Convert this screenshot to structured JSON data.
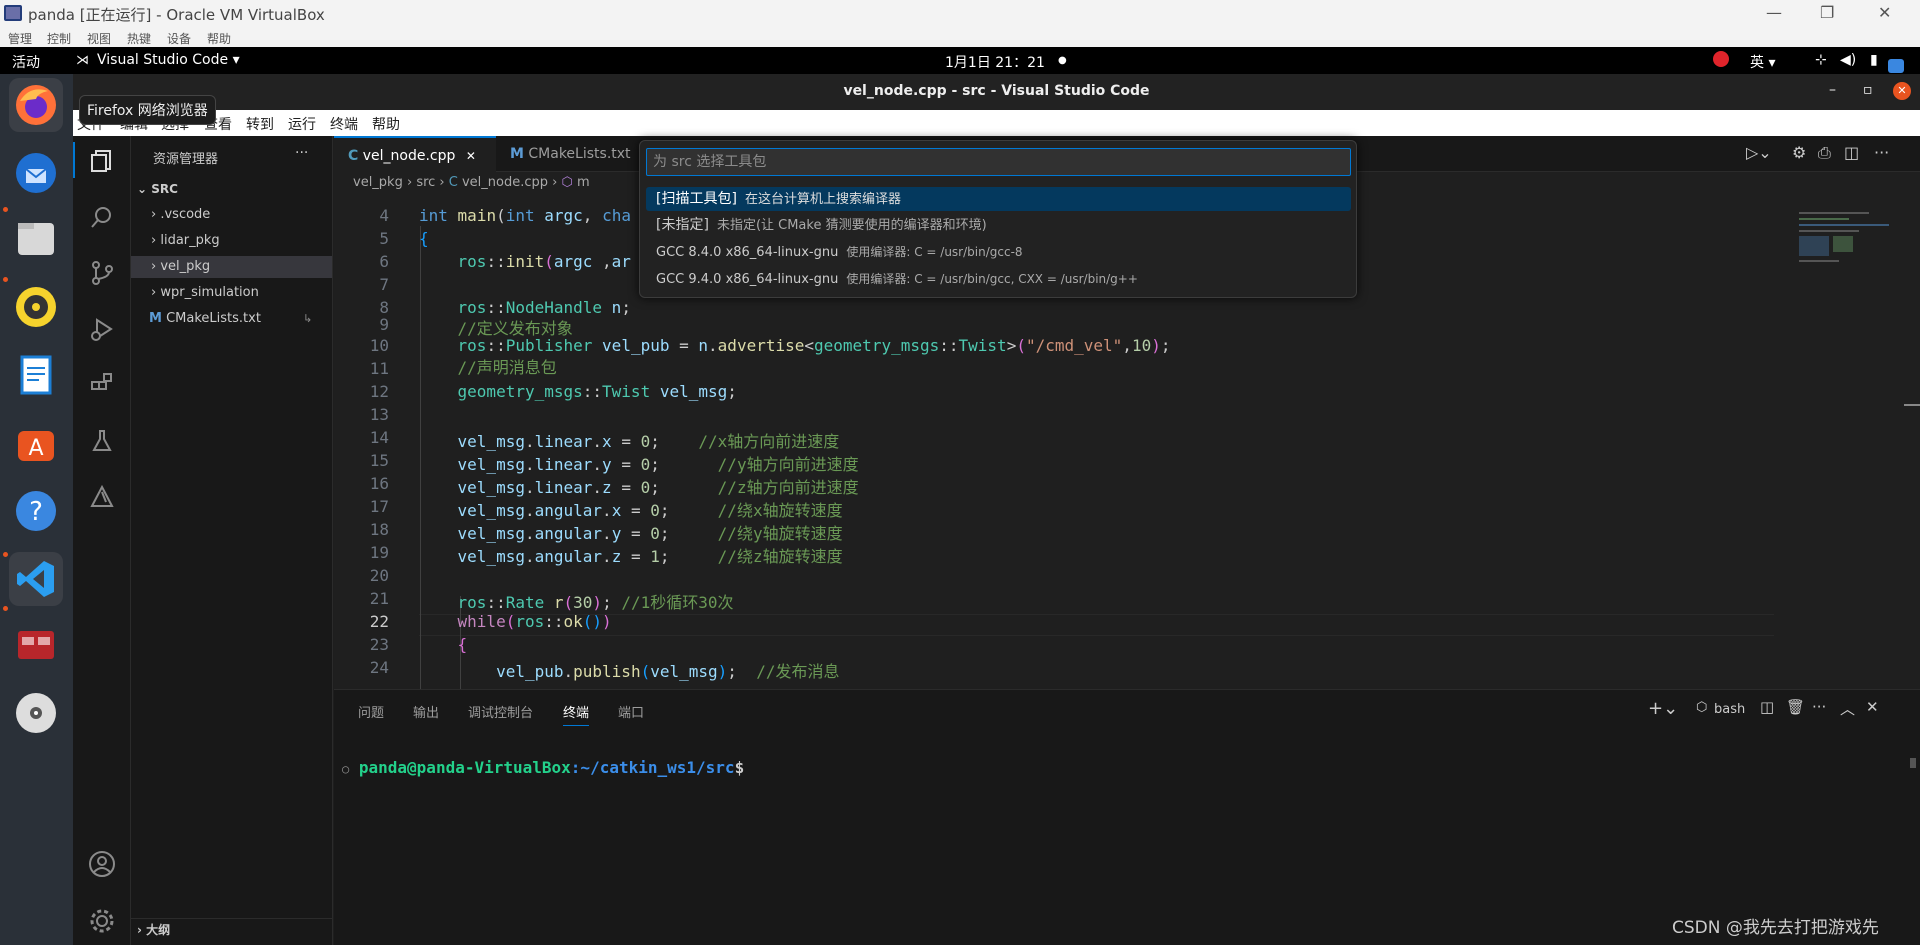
{
  "vbox": {
    "title": "panda [正在运行] - Oracle VM VirtualBox",
    "menu": [
      "管理",
      "控制",
      "视图",
      "热键",
      "设备",
      "帮助"
    ],
    "minimize": "—",
    "restore": "❐",
    "close": "✕"
  },
  "gnome": {
    "activities": "活动",
    "app": "Visual Studio Code ▾",
    "clock": "1月1日  21：21",
    "input": "英 ▾",
    "notif": "●"
  },
  "tooltip": "Firefox 网络浏览器",
  "window": {
    "title": "vel_node.cpp - src - Visual Studio Code",
    "min": "–",
    "max": "▫",
    "close": "✕"
  },
  "menubar": [
    "文件",
    "编辑",
    "选择",
    "查看",
    "转到",
    "运行",
    "终端",
    "帮助"
  ],
  "sidebar": {
    "title": "资源管理器",
    "more": "···",
    "root": "SRC",
    "items": [
      ".vscode",
      "lidar_pkg",
      "vel_pkg",
      "wpr_simulation"
    ],
    "file": "CMakeLists.txt",
    "file_badge": "↳",
    "outline": "大纲"
  },
  "tabs": [
    {
      "icon": "C",
      "label": "vel_node.cpp",
      "close": "✕"
    },
    {
      "icon": "M",
      "label": "CMakeLists.txt"
    }
  ],
  "breadcrumb": [
    "vel_pkg",
    "src",
    "vel_node.cpp",
    "m"
  ],
  "quickpick": {
    "placeholder": "为 src 选择工具包",
    "items": [
      {
        "label": "[扫描工具包]",
        "desc": "在这台计算机上搜索编译器"
      },
      {
        "label": "[未指定]",
        "desc": "未指定(让 CMake 猜测要使用的编译器和环境)"
      },
      {
        "label": "GCC 8.4.0 x86_64-linux-gnu",
        "desc": "使用编译器: C = /usr/bin/gcc-8"
      },
      {
        "label": "GCC 9.4.0 x86_64-linux-gnu",
        "desc": "使用编译器: C = /usr/bin/gcc, CXX = /usr/bin/g++"
      }
    ]
  },
  "code": {
    "line_numbers": [
      "4",
      "5",
      "6",
      "7",
      "8",
      "9",
      "10",
      "11",
      "12",
      "13",
      "14",
      "15",
      "16",
      "17",
      "18",
      "19",
      "20",
      "21",
      "22",
      "23",
      "24"
    ],
    "comments": {
      "l9": "//定义发布对象",
      "l11": "//声明消息包",
      "l14": "//x轴方向前进速度",
      "l15": "//y轴方向前进速度",
      "l16": "//z轴方向前进速度",
      "l17": "//绕x轴旋转速度",
      "l18": "//绕y轴旋转速度",
      "l19": "//绕z轴旋转速度",
      "l21": "//1秒循环30次",
      "l24": "//发布消息"
    },
    "topic": "\"/cmd_vel\""
  },
  "panel": {
    "tabs": [
      "问题",
      "输出",
      "调试控制台",
      "终端",
      "端口"
    ],
    "shell": "bash",
    "prompt_user": "panda@panda-VirtualBox",
    "prompt_path": ":~/catkin_ws1/src",
    "prompt_sym": "$",
    "bullet": "○"
  },
  "watermark": "CSDN @我先去打把游戏先",
  "colors": {
    "accent": "#0078d4",
    "keyword": "#569cd6",
    "type": "#4ec9b0",
    "function": "#dcdcaa",
    "comment": "#6a9955",
    "string": "#ce9178",
    "number": "#b5cea8",
    "prompt_user": "#23d18b",
    "prompt_path": "#3b8eea"
  }
}
